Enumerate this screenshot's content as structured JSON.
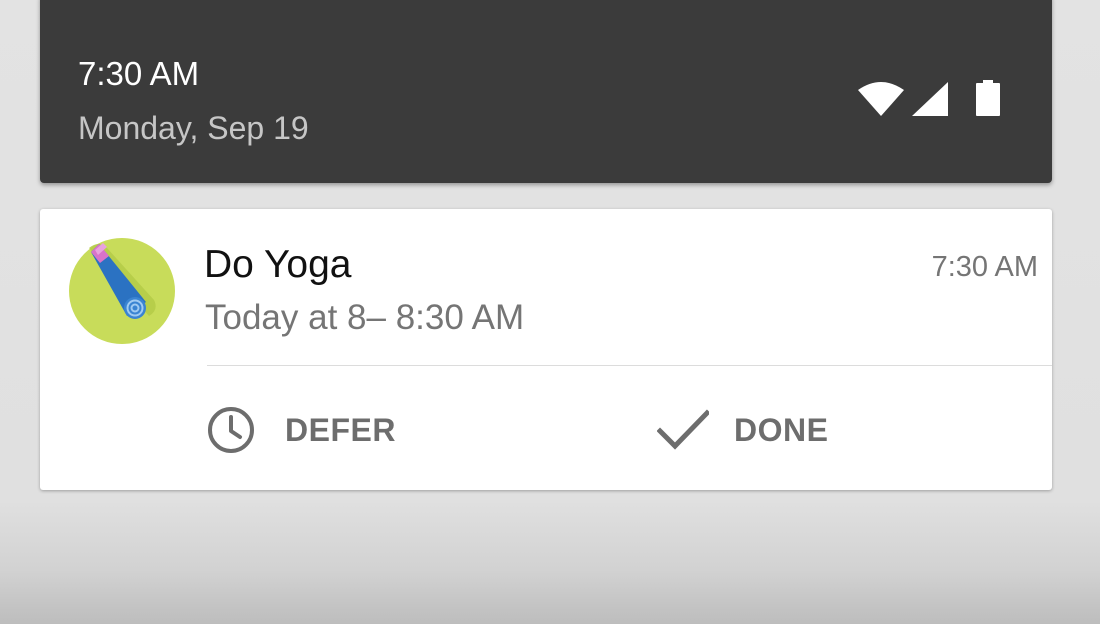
{
  "status_panel": {
    "time": "7:30 AM",
    "date": "Monday, Sep 19",
    "icons": [
      "wifi-icon",
      "cell-signal-icon",
      "battery-icon"
    ]
  },
  "notification": {
    "app_icon": "yoga-mat-icon",
    "title": "Do Yoga",
    "timestamp": "7:30 AM",
    "subtitle": "Today at 8– 8:30 AM",
    "actions": [
      {
        "icon": "clock-icon",
        "label": "DEFER"
      },
      {
        "icon": "check-icon",
        "label": "DONE"
      }
    ]
  },
  "colors": {
    "panel_background": "#3b3b3b",
    "icon_background": "#c8dc5a",
    "mat_blue": "#2b72c2",
    "mat_pink": "#d873c9",
    "action_text": "#6d6d6d"
  }
}
